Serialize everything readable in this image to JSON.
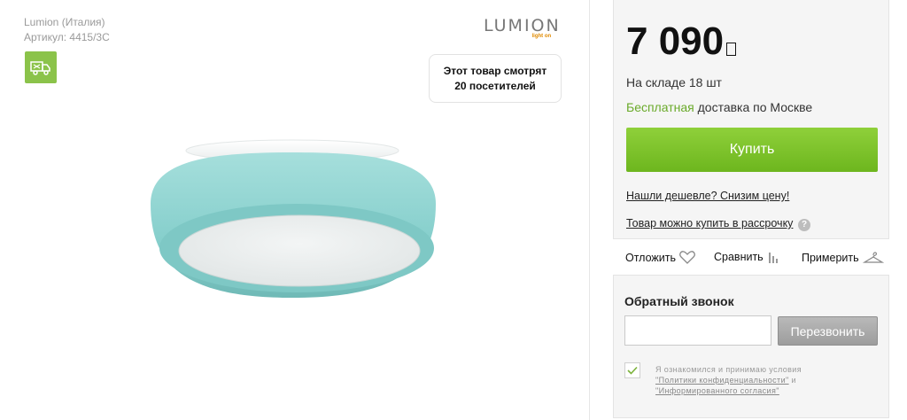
{
  "product": {
    "brand_line": "Lumion (Италия)",
    "sku_line": "Артикул: 4415/3C",
    "viewers_text": "Этот товар смотрят 20 посетителей",
    "logo_text": "LUMION",
    "logo_sub": "light on",
    "lamp_color": "#8fd3d1"
  },
  "buy": {
    "price": "7 090",
    "stock": "На складе 18 шт",
    "free_word": "Бесплатная",
    "delivery_rest": " доставка по Москве",
    "buy_label": "Купить",
    "cheaper_link": "Нашли дешевле? Снизим цену!",
    "installment_link": "Товар можно купить в рассрочку",
    "help_glyph": "?"
  },
  "actions": {
    "wishlist_label": "Отложить",
    "compare_label": "Сравнить",
    "tryon_label": "Примерить"
  },
  "callback": {
    "title": "Обратный звонок",
    "phone_value": "",
    "button_label": "Перезвонить",
    "consent_line1": "Я ознакомился и принимаю условия",
    "privacy_link": "\"Политики конфиденциальности\"",
    "consent_and": " и",
    "agreement_link": "\"Информированного согласия\"",
    "checked": true
  },
  "colors": {
    "accent_green": "#7bc12c",
    "free_green": "#6aaa2a",
    "badge_green": "#8bc34a"
  }
}
